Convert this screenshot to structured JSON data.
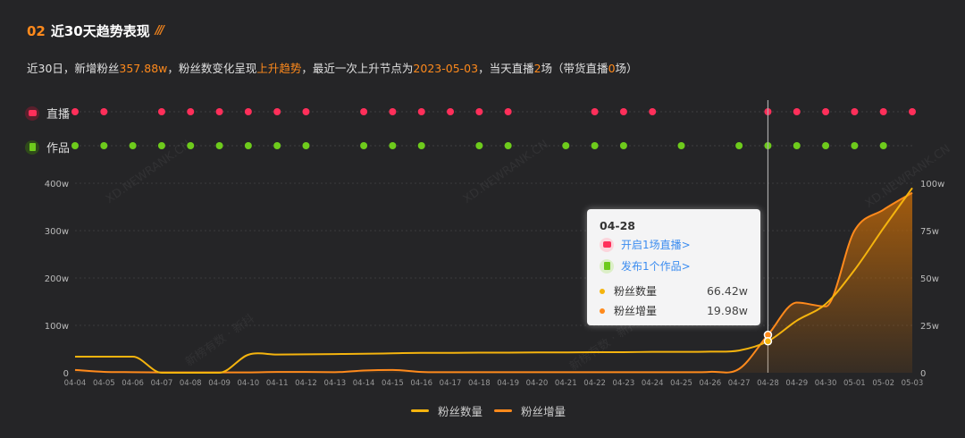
{
  "header": {
    "number": "02",
    "title": "近30天趋势表现"
  },
  "summary": {
    "p1": "近30日，新增粉丝",
    "new_fans": "357.88w",
    "p2": "，粉丝数变化呈现",
    "trend": "上升趋势",
    "p3": "，最近一次上升节点为",
    "node_date": "2023-05-03",
    "p4": "，当天直播",
    "live_count": "2",
    "p5": "场（带货直播",
    "sales_live_count": "0",
    "p6": "场）"
  },
  "rows": {
    "live_label": "直播",
    "works_label": "作品"
  },
  "colors": {
    "live": "#ff2f5a",
    "works": "#6ecb1c",
    "fans": "#f5b40e",
    "increase": "#ff8a1c"
  },
  "watermarks": [
    "XD.NEWRANK.CN",
    "XD.NEWRANK.CN",
    "XD.NEWRANK.CN",
    "新榜有数 · 新抖",
    "新榜有数 · 新抖"
  ],
  "tooltip": {
    "date": "04-28",
    "live_link": "开启1场直播>",
    "works_link": "发布1个作品>",
    "fans_label": "粉丝数量",
    "fans_value": "66.42w",
    "inc_label": "粉丝增量",
    "inc_value": "19.98w"
  },
  "chart_data": {
    "type": "line",
    "x": [
      "04-04",
      "04-05",
      "04-06",
      "04-07",
      "04-08",
      "04-09",
      "04-10",
      "04-11",
      "04-12",
      "04-13",
      "04-14",
      "04-15",
      "04-16",
      "04-17",
      "04-18",
      "04-19",
      "04-20",
      "04-21",
      "04-22",
      "04-23",
      "04-24",
      "04-25",
      "04-26",
      "04-27",
      "04-28",
      "04-29",
      "04-30",
      "05-01",
      "05-02",
      "05-03"
    ],
    "left_axis": {
      "ticks": [
        "0",
        "100w",
        "200w",
        "300w",
        "400w"
      ],
      "range": [
        0,
        400
      ]
    },
    "right_axis": {
      "ticks": [
        "0",
        "25w",
        "50w",
        "75w",
        "100w"
      ],
      "range": [
        0,
        100
      ]
    },
    "series": [
      {
        "name": "粉丝数量",
        "axis": "left",
        "values": [
          34,
          34,
          34,
          0,
          0,
          0,
          38,
          38.5,
          39,
          39.5,
          40,
          41,
          42,
          42,
          42.5,
          42.5,
          43,
          43,
          43.5,
          43.5,
          44,
          44,
          44.5,
          47,
          66.42,
          110,
          145,
          217,
          305,
          390
        ]
      },
      {
        "name": "粉丝增量",
        "axis": "right",
        "values": [
          1.5,
          0.5,
          0.3,
          0.2,
          0.2,
          0.2,
          0.2,
          0.4,
          0.4,
          0.3,
          1.2,
          1.5,
          0.4,
          0.3,
          0.3,
          0.3,
          0.3,
          0.3,
          0.3,
          0.3,
          0.3,
          0.3,
          0.5,
          2,
          19.98,
          37,
          35,
          75,
          86,
          95
        ]
      }
    ],
    "live_days": [
      0,
      1,
      3,
      4,
      5,
      6,
      7,
      8,
      10,
      11,
      12,
      13,
      14,
      15,
      18,
      19,
      20,
      24,
      25,
      26,
      27,
      28,
      29
    ],
    "works_days": [
      0,
      1,
      2,
      3,
      4,
      5,
      6,
      7,
      8,
      10,
      11,
      12,
      14,
      15,
      17,
      18,
      19,
      21,
      23,
      24,
      25,
      26,
      27,
      28
    ],
    "highlight_index": 24,
    "legend": [
      "粉丝数量",
      "粉丝增量"
    ],
    "legend_position": "bottom"
  }
}
